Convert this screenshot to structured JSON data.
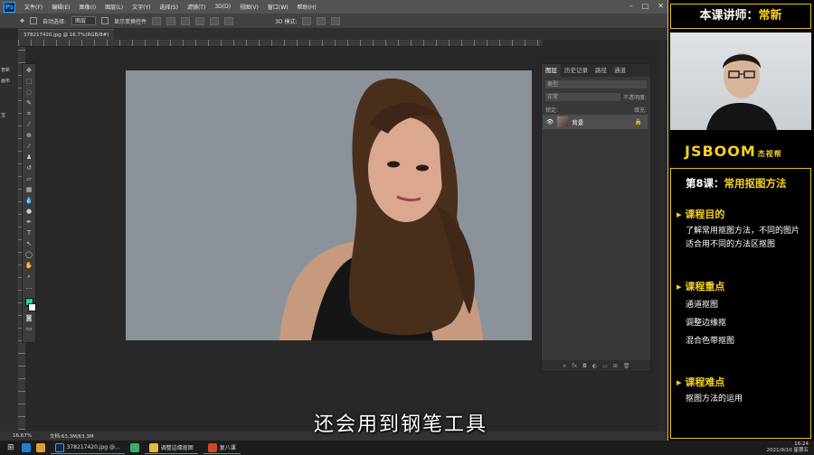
{
  "ps": {
    "logo": "Ps",
    "menu": [
      "文件(F)",
      "编辑(E)",
      "图像(I)",
      "图层(L)",
      "文字(Y)",
      "选择(S)",
      "滤镜(T)",
      "3D(D)",
      "视图(V)",
      "窗口(W)",
      "帮助(H)"
    ],
    "options": {
      "auto_select": "自动选择:",
      "layer_select": "图层",
      "show_transform": "显示变换控件",
      "mode_3d": "3D 模式:"
    },
    "doc_tab": "378217420.jpg @ 16.7%(RGB/8#)",
    "status": {
      "zoom": "16.67%",
      "doc_size": "文档:63.3M/63.3M"
    },
    "left_labels": [
      "普新",
      "画布",
      "宝"
    ]
  },
  "layers_panel": {
    "tabs": [
      "图层",
      "历史记录",
      "路径",
      "通道"
    ],
    "kind_label": "类型",
    "blend_mode": "正常",
    "opacity_label": "不透明度:",
    "lock_label": "锁定:",
    "fill_label": "填充:",
    "layer_name": "背景"
  },
  "subtitle": "还会用到钢笔工具",
  "side": {
    "teacher_label": "本课讲师：",
    "teacher_name": "常新",
    "brand": "JSBOOM",
    "brand_sub": "杰视帮",
    "lesson_num": "第8课：",
    "lesson_title": "常用抠图方法",
    "goal_title": "课程目的",
    "goal_text": "了解常用抠图方法，不同的图片适合用不同的方法区抠图",
    "key_title": "课程重点",
    "key_items": [
      "通道抠图",
      "调整边缘抠",
      "混合色带抠图"
    ],
    "hard_title": "课程难点",
    "hard_items": [
      "抠图方法的运用"
    ]
  },
  "taskbar": {
    "items": [
      "378217420.jpg @...",
      "调整边缘抠图",
      "复八课"
    ],
    "time": "16:24",
    "date": "2021/9/10 星期五"
  }
}
